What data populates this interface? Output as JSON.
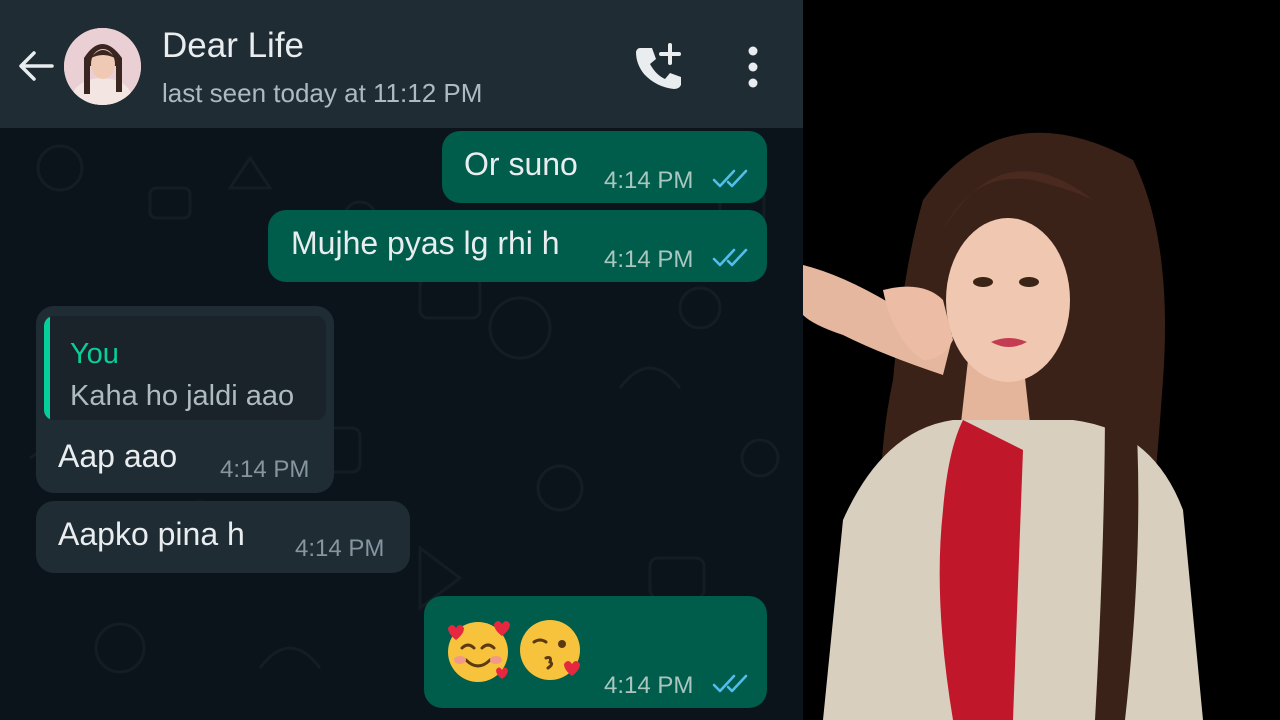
{
  "header": {
    "title": "Dear Life",
    "subtitle": "last seen today at 11:12 PM",
    "back_icon": "arrow-left-icon",
    "call_icon": "add-call-icon",
    "menu_icon": "vertical-dots-icon"
  },
  "messages": [
    {
      "direction": "outgoing",
      "text": "Or suno",
      "time": "4:14 PM",
      "status": "read"
    },
    {
      "direction": "outgoing",
      "text": "Mujhe pyas lg rhi h",
      "time": "4:14 PM",
      "status": "read"
    },
    {
      "direction": "incoming",
      "quote": {
        "author": "You",
        "text": "Kaha ho jaldi aao"
      },
      "text": "Aap aao",
      "time": "4:14 PM"
    },
    {
      "direction": "incoming",
      "text": "Aapko pina h",
      "time": "4:14 PM"
    },
    {
      "direction": "outgoing",
      "emojis": [
        "smiling-face-with-hearts",
        "face-blowing-a-kiss"
      ],
      "time": "4:14 PM",
      "status": "read"
    }
  ],
  "colors": {
    "header_bg": "#1f2c34",
    "chat_bg": "#0b141a",
    "outgoing_bubble": "#005c4b",
    "incoming_bubble": "#1f2c34",
    "quote_accent": "#06cf9c",
    "read_ticks": "#53bdeb"
  }
}
